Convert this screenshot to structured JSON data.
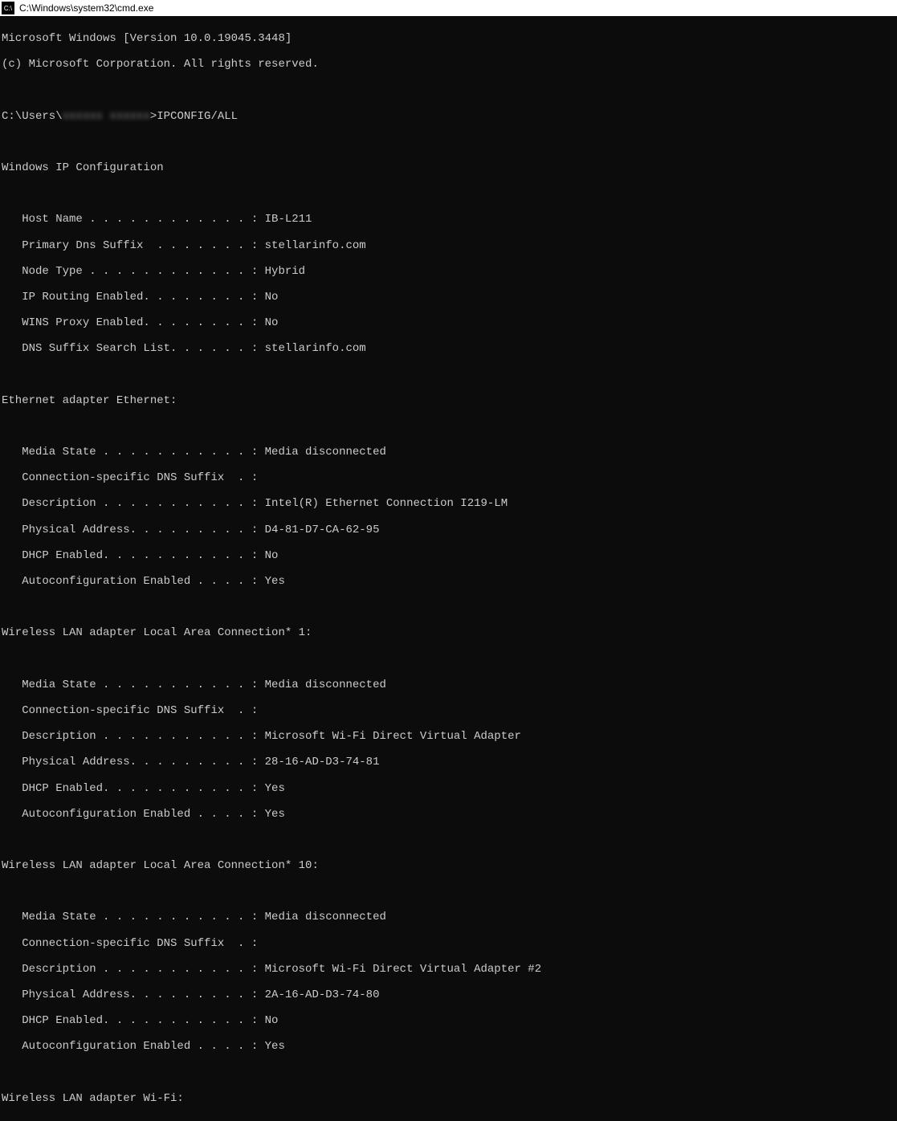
{
  "window": {
    "title": "C:\\Windows\\system32\\cmd.exe"
  },
  "header": {
    "version_line": "Microsoft Windows [Version 10.0.19045.3448]",
    "copyright_line": "(c) Microsoft Corporation. All rights reserved."
  },
  "prompt": {
    "prefix": "C:\\Users\\",
    "user_obscured": "xxxxxx xxxxxx",
    "command": ">IPCONFIG/ALL"
  },
  "sections": {
    "ip_config_header": "Windows IP Configuration",
    "ip_config": [
      "   Host Name . . . . . . . . . . . . : IB-L211",
      "   Primary Dns Suffix  . . . . . . . : stellarinfo.com",
      "   Node Type . . . . . . . . . . . . : Hybrid",
      "   IP Routing Enabled. . . . . . . . : No",
      "   WINS Proxy Enabled. . . . . . . . : No",
      "   DNS Suffix Search List. . . . . . : stellarinfo.com"
    ],
    "ethernet_header": "Ethernet adapter Ethernet:",
    "ethernet": [
      "   Media State . . . . . . . . . . . : Media disconnected",
      "   Connection-specific DNS Suffix  . :",
      "   Description . . . . . . . . . . . : Intel(R) Ethernet Connection I219-LM",
      "   Physical Address. . . . . . . . . : D4-81-D7-CA-62-95",
      "   DHCP Enabled. . . . . . . . . . . : No",
      "   Autoconfiguration Enabled . . . . : Yes"
    ],
    "wlan1_header": "Wireless LAN adapter Local Area Connection* 1:",
    "wlan1": [
      "   Media State . . . . . . . . . . . : Media disconnected",
      "   Connection-specific DNS Suffix  . :",
      "   Description . . . . . . . . . . . : Microsoft Wi-Fi Direct Virtual Adapter",
      "   Physical Address. . . . . . . . . : 28-16-AD-D3-74-81",
      "   DHCP Enabled. . . . . . . . . . . : Yes",
      "   Autoconfiguration Enabled . . . . : Yes"
    ],
    "wlan10_header": "Wireless LAN adapter Local Area Connection* 10:",
    "wlan10": [
      "   Media State . . . . . . . . . . . : Media disconnected",
      "   Connection-specific DNS Suffix  . :",
      "   Description . . . . . . . . . . . : Microsoft Wi-Fi Direct Virtual Adapter #2",
      "   Physical Address. . . . . . . . . : 2A-16-AD-D3-74-80",
      "   DHCP Enabled. . . . . . . . . . . : No",
      "   Autoconfiguration Enabled . . . . : Yes"
    ],
    "wifi_header": "Wireless LAN adapter Wi-Fi:"
  }
}
